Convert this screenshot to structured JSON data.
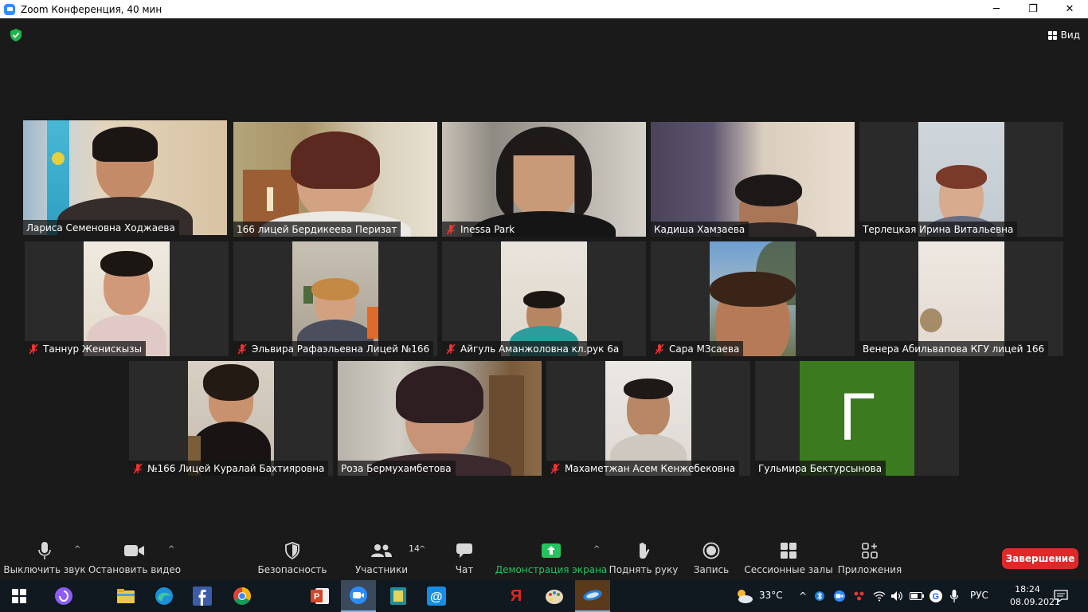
{
  "window": {
    "title": "Zoom Конференция, 40 мин",
    "controls": [
      "─",
      "❐",
      "✕"
    ]
  },
  "meeting": {
    "view_label": "Вид"
  },
  "participants": [
    {
      "name": "Лариса Семеновна Ходжаева",
      "muted": false,
      "active": true
    },
    {
      "name": "166 лицей Бердикеева Перизат",
      "muted": false,
      "active": false
    },
    {
      "name": "Inessa Park",
      "muted": true,
      "active": false
    },
    {
      "name": "Кадиша Хамзаева",
      "muted": false,
      "active": false
    },
    {
      "name": "Терлецкая Ирина Витальевна",
      "muted": false,
      "active": false
    },
    {
      "name": "Таннур Женискызы",
      "muted": true,
      "active": false
    },
    {
      "name": "Эльвира Рафаэльевна Лицей №166",
      "muted": true,
      "active": false
    },
    {
      "name": "Айгуль Аманжоловна кл.рук 6а",
      "muted": true,
      "active": false
    },
    {
      "name": "Сара МЗсаева",
      "muted": true,
      "active": false
    },
    {
      "name": "Венера Абильвапова КГУ лицей 166",
      "muted": false,
      "active": false
    },
    {
      "name": "№166 Лицей Куралай Бахтияровна",
      "muted": true,
      "active": false
    },
    {
      "name": "Роза Бермухамбетова",
      "muted": false,
      "active": false
    },
    {
      "name": "Махаметжан Асем Кенжебековна",
      "muted": true,
      "active": false
    },
    {
      "name": "Гульмира Бектурсынова",
      "muted": false,
      "active": false,
      "avatar_letter": "Г"
    }
  ],
  "toolbar": {
    "mute_label": "Выключить звук",
    "video_label": "Остановить видео",
    "security_label": "Безопасность",
    "participants_label": "Участники",
    "participants_count": "14",
    "chat_label": "Чат",
    "share_label": "Демонстрация экрана",
    "raise_hand_label": "Поднять руку",
    "record_label": "Запись",
    "breakout_label": "Сессионные залы",
    "apps_label": "Приложения",
    "end_label": "Завершение"
  },
  "taskbar": {
    "weather_temp": "33°C",
    "language": "РУС",
    "time": "18:24",
    "date": "08.09.2021"
  },
  "colors": {
    "active_speaker": "#d6e85a",
    "share_green": "#22c45e",
    "end_red": "#e02828",
    "avatar_green": "#3b7a1f"
  }
}
